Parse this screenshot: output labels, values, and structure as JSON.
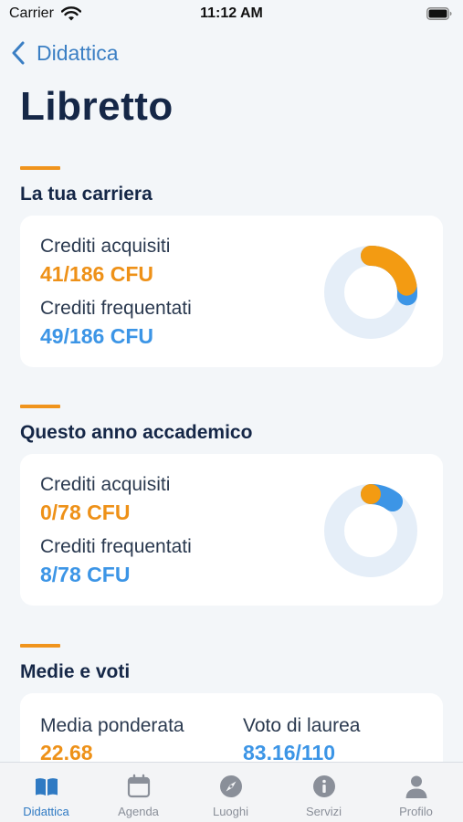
{
  "status_bar": {
    "carrier": "Carrier",
    "time": "11:12 AM"
  },
  "nav": {
    "back_label": "Didattica"
  },
  "page": {
    "title": "Libretto"
  },
  "career": {
    "section_title": "La tua carriera",
    "acquired_label": "Crediti acquisiti",
    "acquired_value": "41/186 CFU",
    "acquired_fraction": 0.2204,
    "attended_label": "Crediti frequentati",
    "attended_value": "49/186 CFU",
    "attended_fraction": 0.2634
  },
  "academic_year": {
    "section_title": "Questo anno accademico",
    "acquired_label": "Crediti acquisiti",
    "acquired_value": "0/78 CFU",
    "acquired_fraction": 0,
    "attended_label": "Crediti frequentati",
    "attended_value": "8/78 CFU",
    "attended_fraction": 0.1026
  },
  "grades": {
    "section_title": "Medie e voti",
    "weighted_label": "Media ponderata",
    "weighted_value": "22.68",
    "degree_label": "Voto di laurea",
    "degree_value": "83.16/110"
  },
  "tabs": [
    {
      "label": "Didattica",
      "icon": "book-icon",
      "active": true
    },
    {
      "label": "Agenda",
      "icon": "calendar-icon",
      "active": false
    },
    {
      "label": "Luoghi",
      "icon": "compass-icon",
      "active": false
    },
    {
      "label": "Servizi",
      "icon": "info-icon",
      "active": false
    },
    {
      "label": "Profilo",
      "icon": "person-icon",
      "active": false
    }
  ],
  "colors": {
    "accent_orange": "#f0941d",
    "link_blue": "#3b7fc4",
    "donut_track": "#e5eef8",
    "donut_orange": "#f39b12",
    "donut_blue": "#3c95e6",
    "title_navy": "#152747"
  }
}
